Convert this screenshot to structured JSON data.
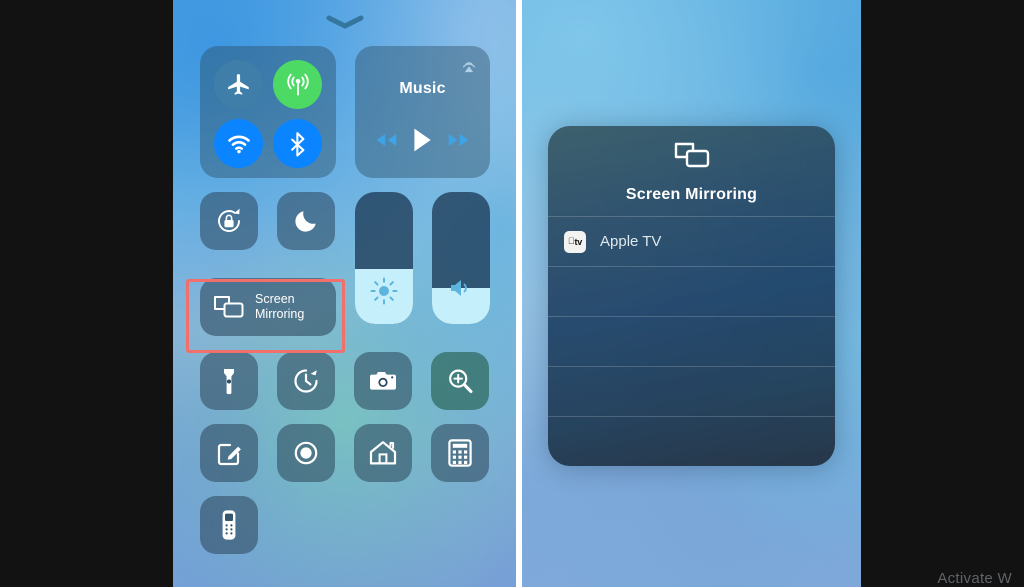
{
  "screen": {
    "background_color": "#121212",
    "watermark_text": "Activate W"
  },
  "left_panel": {
    "name": "iOS Control Center",
    "grabber_icon": "chevron-down-icon",
    "connectivity": {
      "toggles": [
        {
          "id": "airplane-mode",
          "label": "Airplane Mode",
          "icon": "airplane-icon",
          "state": "off",
          "color": "#3e7ea8"
        },
        {
          "id": "cellular-data",
          "label": "Cellular Data",
          "icon": "cellular-antenna-icon",
          "state": "on",
          "color": "#4cd964"
        },
        {
          "id": "wifi",
          "label": "Wi-Fi",
          "icon": "wifi-icon",
          "state": "on",
          "color": "#0a84ff"
        },
        {
          "id": "bluetooth",
          "label": "Bluetooth",
          "icon": "bluetooth-icon",
          "state": "on",
          "color": "#0a84ff"
        }
      ]
    },
    "now_playing": {
      "title": "Music",
      "airplay_icon": "airplay-audio-icon",
      "controls": [
        {
          "id": "rewind",
          "label": "Rewind",
          "icon": "rewind-icon"
        },
        {
          "id": "play",
          "label": "Play",
          "icon": "play-icon"
        },
        {
          "id": "fast-forward",
          "label": "Fast Forward",
          "icon": "fast-forward-icon"
        }
      ]
    },
    "toggles_row2": [
      {
        "id": "rotation-lock",
        "label": "Portrait Orientation Lock",
        "icon": "rotation-lock-icon"
      },
      {
        "id": "do-not-disturb",
        "label": "Do Not Disturb",
        "icon": "moon-icon"
      }
    ],
    "sliders": [
      {
        "id": "brightness",
        "label": "Brightness",
        "icon": "brightness-sun-icon",
        "value_percent": 42
      },
      {
        "id": "volume",
        "label": "Volume",
        "icon": "speaker-icon",
        "value_percent": 27
      }
    ],
    "screen_mirroring_tile": {
      "label_line1": "Screen",
      "label_line2": "Mirroring",
      "icon": "screen-mirroring-icon",
      "highlighted": true,
      "highlight_color": "#f2706b"
    },
    "shortcut_rows": [
      [
        {
          "id": "flashlight",
          "label": "Flashlight",
          "icon": "flashlight-icon"
        },
        {
          "id": "timer",
          "label": "Timer",
          "icon": "timer-icon"
        },
        {
          "id": "camera",
          "label": "Camera",
          "icon": "camera-icon"
        },
        {
          "id": "magnifier",
          "label": "Magnifier",
          "icon": "magnifier-icon",
          "tint": "#2f6a52"
        }
      ],
      [
        {
          "id": "notes",
          "label": "Notes",
          "icon": "notes-pencil-icon"
        },
        {
          "id": "screen-record",
          "label": "Screen Recording",
          "icon": "screen-record-icon"
        },
        {
          "id": "home",
          "label": "Home",
          "icon": "home-icon"
        },
        {
          "id": "calculator",
          "label": "Calculator",
          "icon": "calculator-icon"
        }
      ],
      [
        {
          "id": "apple-tv-remote",
          "label": "Apple TV Remote",
          "icon": "remote-icon"
        }
      ]
    ]
  },
  "right_panel": {
    "sheet": {
      "icon": "screen-mirroring-icon",
      "title": "Screen Mirroring",
      "devices": [
        {
          "id": "apple-tv",
          "name": "Apple TV",
          "icon": "appletv-logo-icon",
          "icon_text": "tv"
        }
      ],
      "empty_rows": 4
    }
  }
}
